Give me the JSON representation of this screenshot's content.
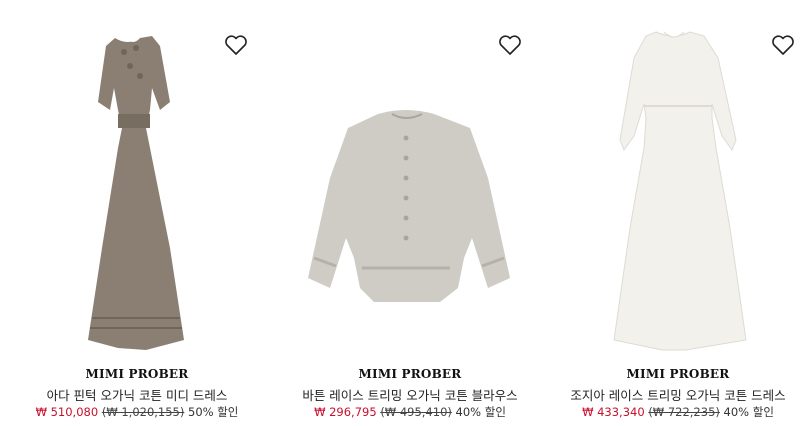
{
  "products": [
    {
      "brand": "MIMI PROBER",
      "name": "아다 핀턱 오가닉 코튼 미디 드레스",
      "sale_price": "₩ 510,080",
      "original_price": "(₩ 1,020,155)",
      "discount": "50% 할인",
      "image_alt": "taupe midi dress",
      "wishlist_icon": "heart-outline-icon"
    },
    {
      "brand": "MIMI PROBER",
      "name": "바튼 레이스 트리밍 오가닉 코튼 블라우스",
      "sale_price": "₩ 296,795",
      "original_price": "(₩ 495,410)",
      "discount": "40% 할인",
      "image_alt": "grey cotton blouse",
      "wishlist_icon": "heart-outline-icon"
    },
    {
      "brand": "MIMI PROBER",
      "name": "조지아 레이스 트리밍 오가닉 코튼 드레스",
      "sale_price": "₩ 433,340",
      "original_price": "(₩ 722,235)",
      "discount": "40% 할인",
      "image_alt": "white cotton dress",
      "wishlist_icon": "heart-outline-icon"
    }
  ],
  "colors": {
    "sale": "#c8102e",
    "text": "#222222",
    "dress1": "#8a7f72",
    "blouse": "#cfccc6",
    "dress3": "#f3f1ec"
  }
}
